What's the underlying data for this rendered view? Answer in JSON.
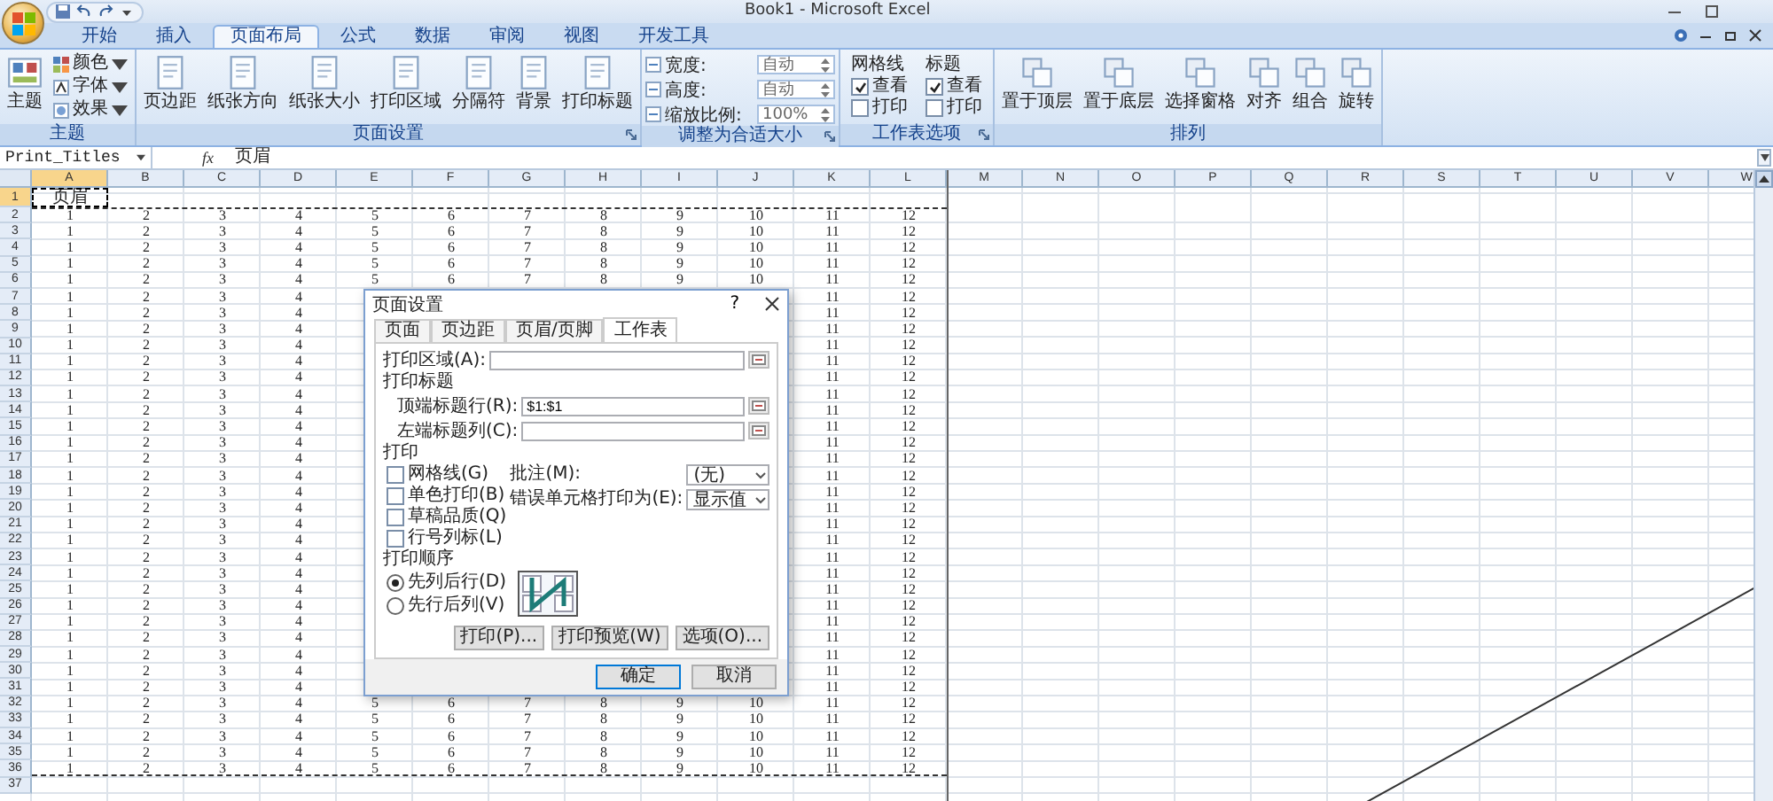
{
  "title_bar": {
    "title": "Book1 - Microsoft Excel"
  },
  "tabs": [
    {
      "label": "开始",
      "selected": false
    },
    {
      "label": "插入",
      "selected": false
    },
    {
      "label": "页面布局",
      "selected": true
    },
    {
      "label": "公式",
      "selected": false
    },
    {
      "label": "数据",
      "selected": false
    },
    {
      "label": "审阅",
      "selected": false
    },
    {
      "label": "视图",
      "selected": false
    },
    {
      "label": "开发工具",
      "selected": false
    }
  ],
  "ribbon": {
    "groups": [
      {
        "label": "主题",
        "kind": "theme",
        "launcher": false,
        "big": "主题",
        "small": [
          "颜色",
          "字体",
          "效果"
        ]
      },
      {
        "label": "页面设置",
        "kind": "buttons",
        "launcher": true,
        "buttons": [
          "页边距",
          "纸张方向",
          "纸张大小",
          "打印区域",
          "分隔符",
          "背景",
          "打印标题"
        ]
      },
      {
        "label": "调整为合适大小",
        "kind": "fields",
        "launcher": true,
        "fields": [
          {
            "label": "宽度:",
            "value": "自动"
          },
          {
            "label": "高度:",
            "value": "自动"
          },
          {
            "label": "缩放比例:",
            "value": "100%"
          }
        ]
      },
      {
        "label": "工作表选项",
        "kind": "options",
        "launcher": true,
        "columns": [
          {
            "heading": "网格线",
            "options": [
              {
                "label": "查看",
                "checked": true
              },
              {
                "label": "打印",
                "checked": false
              }
            ]
          },
          {
            "heading": "标题",
            "options": [
              {
                "label": "查看",
                "checked": true
              },
              {
                "label": "打印",
                "checked": false
              }
            ]
          }
        ]
      },
      {
        "label": "排列",
        "kind": "buttons",
        "launcher": false,
        "buttons": [
          "置于顶层",
          "置于底层",
          "选择窗格",
          "对齐",
          "组合",
          "旋转"
        ]
      }
    ]
  },
  "formula_bar": {
    "name_box": "Print_Titles",
    "function_button": "fx",
    "formula": "页眉"
  },
  "grid": {
    "columns": [
      {
        "label": "A",
        "selected": true
      },
      {
        "label": "B",
        "selected": false
      },
      {
        "label": "C",
        "selected": false
      },
      {
        "label": "D",
        "selected": false
      },
      {
        "label": "E",
        "selected": false
      },
      {
        "label": "F",
        "selected": false
      },
      {
        "label": "G",
        "selected": false
      },
      {
        "label": "H",
        "selected": false
      },
      {
        "label": "I",
        "selected": false
      },
      {
        "label": "J",
        "selected": false
      },
      {
        "label": "K",
        "selected": false
      },
      {
        "label": "L",
        "selected": false
      },
      {
        "label": "M",
        "selected": false
      },
      {
        "label": "N",
        "selected": false
      },
      {
        "label": "O",
        "selected": false
      },
      {
        "label": "P",
        "selected": false
      },
      {
        "label": "Q",
        "selected": false
      },
      {
        "label": "R",
        "selected": false
      },
      {
        "label": "S",
        "selected": false
      },
      {
        "label": "T",
        "selected": false
      },
      {
        "label": "U",
        "selected": false
      },
      {
        "label": "V",
        "selected": false
      },
      {
        "label": "W",
        "selected": false
      }
    ],
    "rows": [
      {
        "label": "1",
        "selected": true,
        "cells": [
          "页眉"
        ]
      },
      {
        "label": "2",
        "selected": false,
        "cells": [
          "1",
          "2",
          "3",
          "4",
          "5",
          "6",
          "7",
          "8",
          "9",
          "10",
          "11",
          "12"
        ]
      },
      {
        "label": "3",
        "selected": false,
        "cells": [
          "1",
          "2",
          "3",
          "4",
          "5",
          "6",
          "7",
          "8",
          "9",
          "10",
          "11",
          "12"
        ]
      },
      {
        "label": "4",
        "selected": false,
        "cells": [
          "1",
          "2",
          "3",
          "4",
          "5",
          "6",
          "7",
          "8",
          "9",
          "10",
          "11",
          "12"
        ]
      },
      {
        "label": "5",
        "selected": false,
        "cells": [
          "1",
          "2",
          "3",
          "4",
          "5",
          "6",
          "7",
          "8",
          "9",
          "10",
          "11",
          "12"
        ]
      },
      {
        "label": "6",
        "selected": false,
        "cells": [
          "1",
          "2",
          "3",
          "4",
          "5",
          "6",
          "7",
          "8",
          "9",
          "10",
          "11",
          "12"
        ]
      },
      {
        "label": "7",
        "selected": false,
        "cells": [
          "1",
          "2",
          "3",
          "4",
          null,
          null,
          null,
          null,
          null,
          null,
          "11",
          "12"
        ]
      },
      {
        "label": "8",
        "selected": false,
        "cells": [
          "1",
          "2",
          "3",
          "4",
          null,
          null,
          null,
          null,
          null,
          null,
          "11",
          "12"
        ]
      },
      {
        "label": "9",
        "selected": false,
        "cells": [
          "1",
          "2",
          "3",
          "4",
          null,
          null,
          null,
          null,
          null,
          null,
          "11",
          "12"
        ]
      },
      {
        "label": "10",
        "selected": false,
        "cells": [
          "1",
          "2",
          "3",
          "4",
          null,
          null,
          null,
          null,
          null,
          null,
          "11",
          "12"
        ]
      },
      {
        "label": "11",
        "selected": false,
        "cells": [
          "1",
          "2",
          "3",
          "4",
          null,
          null,
          null,
          null,
          null,
          null,
          "11",
          "12"
        ]
      },
      {
        "label": "12",
        "selected": false,
        "cells": [
          "1",
          "2",
          "3",
          "4",
          null,
          null,
          null,
          null,
          null,
          null,
          "11",
          "12"
        ]
      },
      {
        "label": "13",
        "selected": false,
        "cells": [
          "1",
          "2",
          "3",
          "4",
          null,
          null,
          null,
          null,
          null,
          null,
          "11",
          "12"
        ]
      },
      {
        "label": "14",
        "selected": false,
        "cells": [
          "1",
          "2",
          "3",
          "4",
          null,
          null,
          null,
          null,
          null,
          null,
          "11",
          "12"
        ]
      },
      {
        "label": "15",
        "selected": false,
        "cells": [
          "1",
          "2",
          "3",
          "4",
          null,
          null,
          null,
          null,
          null,
          null,
          "11",
          "12"
        ]
      },
      {
        "label": "16",
        "selected": false,
        "cells": [
          "1",
          "2",
          "3",
          "4",
          null,
          null,
          null,
          null,
          null,
          null,
          "11",
          "12"
        ]
      },
      {
        "label": "17",
        "selected": false,
        "cells": [
          "1",
          "2",
          "3",
          "4",
          null,
          null,
          null,
          null,
          null,
          null,
          "11",
          "12"
        ]
      },
      {
        "label": "18",
        "selected": false,
        "cells": [
          "1",
          "2",
          "3",
          "4",
          null,
          null,
          null,
          null,
          null,
          null,
          "11",
          "12"
        ]
      },
      {
        "label": "19",
        "selected": false,
        "cells": [
          "1",
          "2",
          "3",
          "4",
          null,
          null,
          null,
          null,
          null,
          null,
          "11",
          "12"
        ]
      },
      {
        "label": "20",
        "selected": false,
        "cells": [
          "1",
          "2",
          "3",
          "4",
          null,
          null,
          null,
          null,
          null,
          null,
          "11",
          "12"
        ]
      },
      {
        "label": "21",
        "selected": false,
        "cells": [
          "1",
          "2",
          "3",
          "4",
          null,
          null,
          null,
          null,
          null,
          null,
          "11",
          "12"
        ]
      },
      {
        "label": "22",
        "selected": false,
        "cells": [
          "1",
          "2",
          "3",
          "4",
          null,
          null,
          null,
          null,
          null,
          null,
          "11",
          "12"
        ]
      },
      {
        "label": "23",
        "selected": false,
        "cells": [
          "1",
          "2",
          "3",
          "4",
          null,
          null,
          null,
          null,
          null,
          null,
          "11",
          "12"
        ]
      },
      {
        "label": "24",
        "selected": false,
        "cells": [
          "1",
          "2",
          "3",
          "4",
          null,
          null,
          null,
          null,
          null,
          null,
          "11",
          "12"
        ]
      },
      {
        "label": "25",
        "selected": false,
        "cells": [
          "1",
          "2",
          "3",
          "4",
          null,
          null,
          null,
          null,
          null,
          null,
          "11",
          "12"
        ]
      },
      {
        "label": "26",
        "selected": false,
        "cells": [
          "1",
          "2",
          "3",
          "4",
          null,
          null,
          null,
          null,
          null,
          null,
          "11",
          "12"
        ]
      },
      {
        "label": "27",
        "selected": false,
        "cells": [
          "1",
          "2",
          "3",
          "4",
          null,
          null,
          null,
          null,
          null,
          null,
          "11",
          "12"
        ]
      },
      {
        "label": "28",
        "selected": false,
        "cells": [
          "1",
          "2",
          "3",
          "4",
          null,
          null,
          null,
          null,
          null,
          null,
          "11",
          "12"
        ]
      },
      {
        "label": "29",
        "selected": false,
        "cells": [
          "1",
          "2",
          "3",
          "4",
          null,
          null,
          null,
          null,
          null,
          null,
          "11",
          "12"
        ]
      },
      {
        "label": "30",
        "selected": false,
        "cells": [
          "1",
          "2",
          "3",
          "4",
          null,
          null,
          null,
          null,
          null,
          null,
          "11",
          "12"
        ]
      },
      {
        "label": "31",
        "selected": false,
        "cells": [
          "1",
          "2",
          "3",
          "4",
          null,
          null,
          null,
          null,
          null,
          null,
          "11",
          "12"
        ]
      },
      {
        "label": "32",
        "selected": false,
        "cells": [
          "1",
          "2",
          "3",
          "4",
          "5",
          "6",
          "7",
          "8",
          "9",
          "10",
          "11",
          "12"
        ]
      },
      {
        "label": "33",
        "selected": false,
        "cells": [
          "1",
          "2",
          "3",
          "4",
          "5",
          "6",
          "7",
          "8",
          "9",
          "10",
          "11",
          "12"
        ]
      },
      {
        "label": "34",
        "selected": false,
        "cells": [
          "1",
          "2",
          "3",
          "4",
          "5",
          "6",
          "7",
          "8",
          "9",
          "10",
          "11",
          "12"
        ]
      },
      {
        "label": "35",
        "selected": false,
        "cells": [
          "1",
          "2",
          "3",
          "4",
          "5",
          "6",
          "7",
          "8",
          "9",
          "10",
          "11",
          "12"
        ]
      },
      {
        "label": "36",
        "selected": false,
        "cells": [
          "1",
          "2",
          "3",
          "4",
          "5",
          "6",
          "7",
          "8",
          "9",
          "10",
          "11",
          "12"
        ]
      },
      {
        "label": "37",
        "selected": false
      }
    ]
  },
  "dialog": {
    "title": "页面设置",
    "help": "?",
    "tabs": [
      {
        "label": "页面",
        "selected": false
      },
      {
        "label": "页边距",
        "selected": false
      },
      {
        "label": "页眉/页脚",
        "selected": false
      },
      {
        "label": "工作表",
        "selected": true
      }
    ],
    "print_area": {
      "label": "打印区域(A):"
    },
    "titles_heading": "打印标题",
    "title_rows": {
      "label": "顶端标题行(R):",
      "value": "$1:$1"
    },
    "title_columns": {
      "label": "左端标题列(C):"
    },
    "print_heading": "打印",
    "checkboxes": [
      {
        "label": "网格线(G)",
        "checked": false
      },
      {
        "label": "单色打印(B)",
        "checked": false
      },
      {
        "label": "草稿品质(Q)",
        "checked": false
      },
      {
        "label": "行号列标(L)",
        "checked": false
      }
    ],
    "comments": {
      "label": "批注(M):",
      "value": "(无)"
    },
    "errors": {
      "label": "错误单元格打印为(E):",
      "value": "显示值"
    },
    "order_heading": "打印顺序",
    "order": [
      {
        "label": "先列后行(D)",
        "selected": true
      },
      {
        "label": "先行后列(V)",
        "selected": false
      }
    ],
    "buttons": [
      "打印(P)...",
      "打印预览(W)",
      "选项(O)..."
    ],
    "footer_buttons": [
      "确定",
      "取消"
    ]
  }
}
